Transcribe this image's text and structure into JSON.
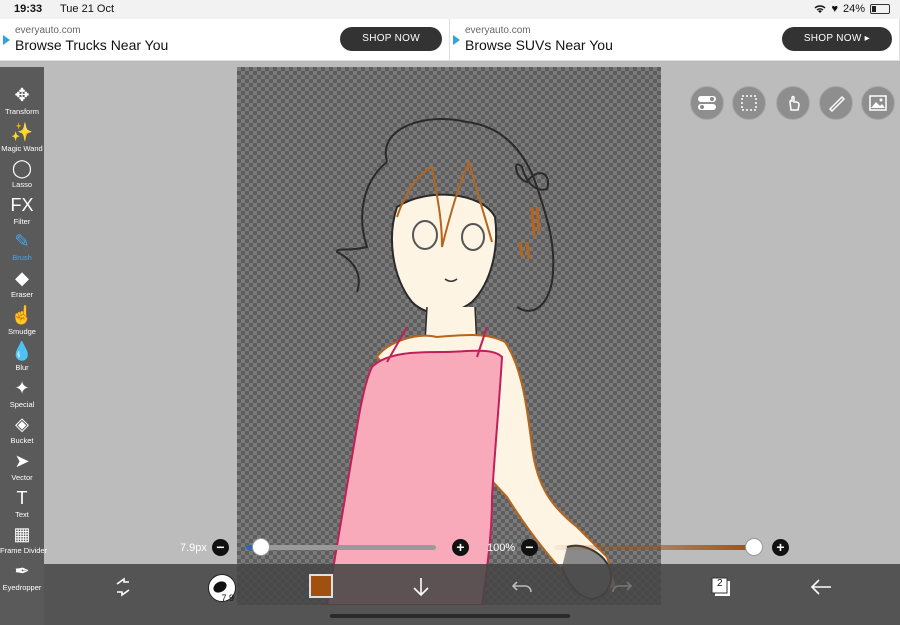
{
  "status": {
    "time": "19:33",
    "date": "Tue 21 Oct",
    "battery": "24%"
  },
  "ads": [
    {
      "domain": "everyauto.com",
      "headline": "Browse Trucks Near You",
      "cta": "SHOP NOW"
    },
    {
      "domain": "everyauto.com",
      "headline": "Browse SUVs Near You",
      "cta": "SHOP NOW ▸"
    }
  ],
  "tools": [
    {
      "label": "Transform",
      "icon": "move-arrows-icon",
      "glyph": "✥"
    },
    {
      "label": "Magic Wand",
      "icon": "magic-wand-icon",
      "glyph": "✨"
    },
    {
      "label": "Lasso",
      "icon": "lasso-icon",
      "glyph": "◯"
    },
    {
      "label": "Filter",
      "icon": "fx-icon",
      "glyph": "FX"
    },
    {
      "label": "Brush",
      "icon": "brush-icon",
      "glyph": "✎"
    },
    {
      "label": "Eraser",
      "icon": "eraser-icon",
      "glyph": "◆"
    },
    {
      "label": "Smudge",
      "icon": "smudge-icon",
      "glyph": "☝"
    },
    {
      "label": "Blur",
      "icon": "blur-drop-icon",
      "glyph": "💧"
    },
    {
      "label": "Special",
      "icon": "special-wand-icon",
      "glyph": "✦"
    },
    {
      "label": "Bucket",
      "icon": "bucket-icon",
      "glyph": "◈"
    },
    {
      "label": "Vector",
      "icon": "vector-arrow-icon",
      "glyph": "➤"
    },
    {
      "label": "Text",
      "icon": "text-icon",
      "glyph": "T"
    },
    {
      "label": "Frame Divider",
      "icon": "frame-divider-icon",
      "glyph": "▦"
    },
    {
      "label": "Eyedropper",
      "icon": "eyedropper-icon",
      "glyph": "✒"
    }
  ],
  "active_tool": "Brush",
  "brush": {
    "size_label": "7.9px",
    "size_value": 7.9,
    "size_fraction": 0.08,
    "opacity_label": "100%",
    "opacity_fraction": 1.0
  },
  "bottom": {
    "brush_preview_label": "7.9",
    "layer_count": "2",
    "current_color": "#a0500f"
  }
}
